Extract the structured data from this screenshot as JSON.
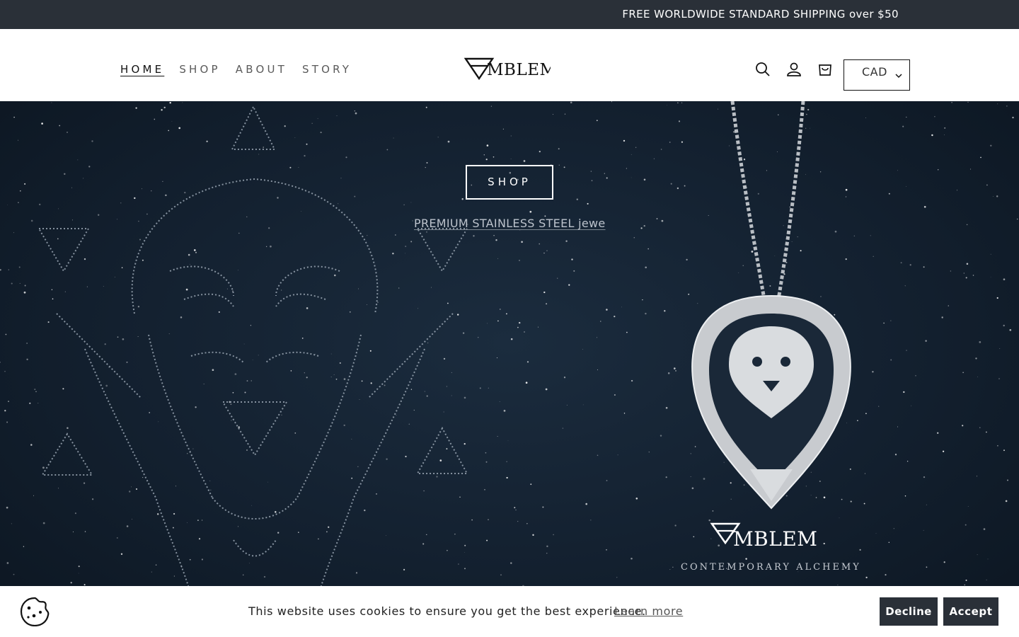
{
  "announcement": {
    "text": "FREE WORLDWIDE STANDARD SHIPPING over $50"
  },
  "header": {
    "nav": [
      {
        "label": "HOME",
        "active": true
      },
      {
        "label": "SHOP",
        "active": false
      },
      {
        "label": "ABOUT",
        "active": false
      },
      {
        "label": "STORY",
        "active": false
      }
    ],
    "logo_text": "EMBLEM",
    "icons": [
      "search-icon",
      "account-icon",
      "cart-icon"
    ],
    "currency": {
      "selected": "CAD"
    }
  },
  "hero": {
    "button_label": "SHOP",
    "subtitle": "PREMIUM STAINLESS STEEL jewe",
    "brand_name": "EMBLEM",
    "brand_tagline": "CONTEMPORARY ALCHEMY"
  },
  "cookie_banner": {
    "message": "This website uses cookies to ensure you get the best experience.",
    "learn_more": "Learn more",
    "decline_label": "Decline",
    "accept_label": "Accept"
  },
  "colors": {
    "announcement_bg": "#2a3038",
    "hero_bg": "#13202f",
    "button_bg": "#2a3038"
  }
}
